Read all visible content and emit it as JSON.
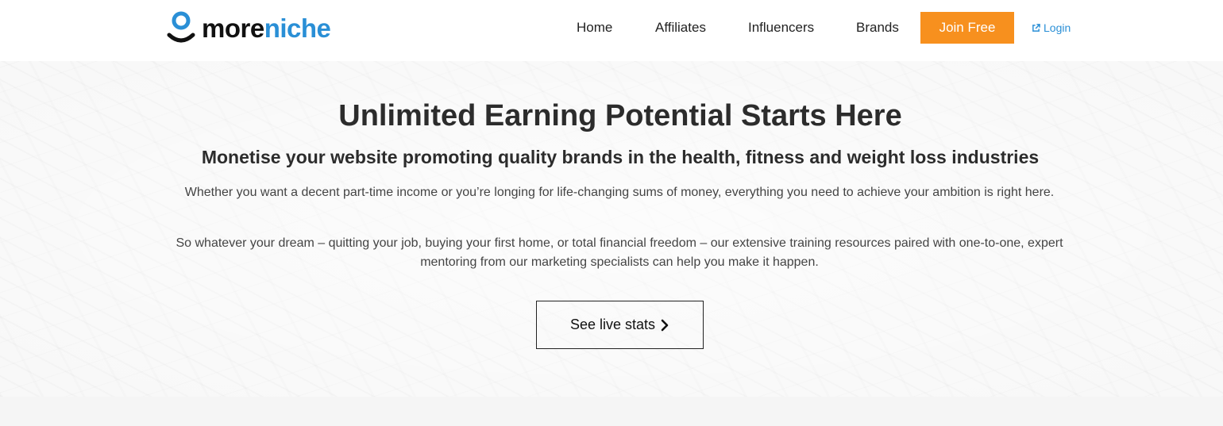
{
  "brand": {
    "logo_part1": "more",
    "logo_part2": "niche",
    "color_primary": "#2a8fd6",
    "color_dark": "#111111"
  },
  "nav": {
    "items": [
      {
        "label": "Home"
      },
      {
        "label": "Affiliates"
      },
      {
        "label": "Influencers"
      },
      {
        "label": "Brands"
      }
    ],
    "join_label": "Join Free",
    "join_color": "#f7901e",
    "login_label": "Login",
    "login_icon": "external-link-icon"
  },
  "hero": {
    "title": "Unlimited Earning Potential Starts Here",
    "subtitle": "Monetise your website promoting quality brands in the health, fitness and weight loss industries",
    "paragraph1": "Whether you want a decent part-time income or you’re longing for life-changing sums of money, everything you need to achieve your ambition is right here.",
    "paragraph2": "So whatever your dream – quitting your job, buying your first home, or total financial freedom – our extensive training resources paired with one-to-one, expert mentoring from our marketing specialists can help you make it happen.",
    "cta_label": "See live stats",
    "cta_icon": "chevron-right-icon"
  }
}
